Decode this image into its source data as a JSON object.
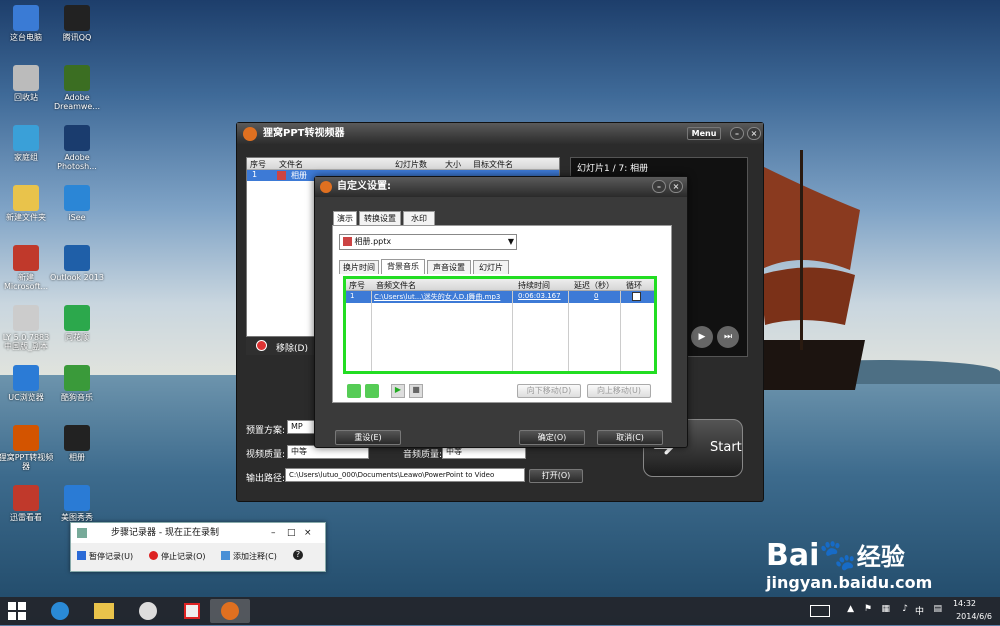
{
  "desktop": {
    "icons": [
      {
        "label": "这台电脑",
        "color": "#3a7bd5"
      },
      {
        "label": "腾讯QQ",
        "color": "#222"
      },
      {
        "label": "回收站",
        "color": "#bbb"
      },
      {
        "label": "Adobe Dreamwe...",
        "color": "#3b6e22"
      },
      {
        "label": "家庭组",
        "color": "#3aa0d8"
      },
      {
        "label": "Adobe Photosh...",
        "color": "#1a3c6e"
      },
      {
        "label": "新建文件夹",
        "color": "#e9c34b"
      },
      {
        "label": "iSee",
        "color": "#2b86d6"
      },
      {
        "label": "新建 Microsoft...",
        "color": "#c0392b"
      },
      {
        "label": "Outlook 2013",
        "color": "#1f5fa8"
      },
      {
        "label": "LY 5.0.7883 中国版_副本",
        "color": "#ccc"
      },
      {
        "label": "同花顺",
        "color": "#2ca84c"
      },
      {
        "label": "UC浏览器",
        "color": "#2b7bd6"
      },
      {
        "label": "酷狗音乐",
        "color": "#3a9a3a"
      },
      {
        "label": "狸窝PPT转视频器",
        "color": "#d35400"
      },
      {
        "label": "相册",
        "color": "#222"
      },
      {
        "label": "迅雷看看",
        "color": "#c0392b"
      },
      {
        "label": "美图秀秀",
        "color": "#2a7bd5"
      }
    ]
  },
  "main_window": {
    "title": "狸窝PPT转视频器",
    "menu_label": "Menu",
    "list_headers": [
      "序号",
      "文件名",
      "幻灯片数",
      "大小",
      "目标文件名"
    ],
    "list_row": {
      "index": "1",
      "name": "相册"
    },
    "remove_label": "移除(D)",
    "preview_label": "幻灯片1 / 7: 相册",
    "preset_label": "预置方案:",
    "preset_value": "MP",
    "quality_label": "视频质量:",
    "quality_value": "中等",
    "audio_label": "音频质量:",
    "audio_value": "中等",
    "output_label": "输出路径:",
    "output_value": "C:\\Users\\lutuo_000\\Documents\\Leawo\\PowerPoint to Video",
    "open_button": "打开(O)",
    "start_button": "Start"
  },
  "dialog": {
    "title": "自定义设置:",
    "tabs": [
      "演示",
      "转换设置",
      "水印"
    ],
    "file_select": "相册.pptx",
    "sub_tabs": [
      "换片时间",
      "背景音乐",
      "声音设置",
      "幻灯片"
    ],
    "table_headers": [
      "序号",
      "音频文件名",
      "持续时间",
      "延迟（秒）",
      "循环"
    ],
    "row": {
      "index": "1",
      "file": "C:\\Users\\lut...\\迷失的女人D.J舞曲.mp3",
      "duration": "0:06:03.167",
      "delay": "0"
    },
    "move_down": "向下移动(D)",
    "move_up": "向上移动(U)",
    "reset": "重设(E)",
    "ok": "确定(O)",
    "cancel": "取消(C)",
    "highlight_color": "#22dd22"
  },
  "steps_recorder": {
    "title": "步骤记录器 - 现在正在录制",
    "pause": "暂停记录(U)",
    "stop": "停止记录(O)",
    "add_comment": "添加注释(C)",
    "help": "?"
  },
  "taskbar": {
    "time": "14:32",
    "date": "2014/6/6",
    "ime": "中"
  },
  "watermark": {
    "logo": "Bai",
    "logo2": "经验",
    "url": "jingyan.baidu.com"
  }
}
